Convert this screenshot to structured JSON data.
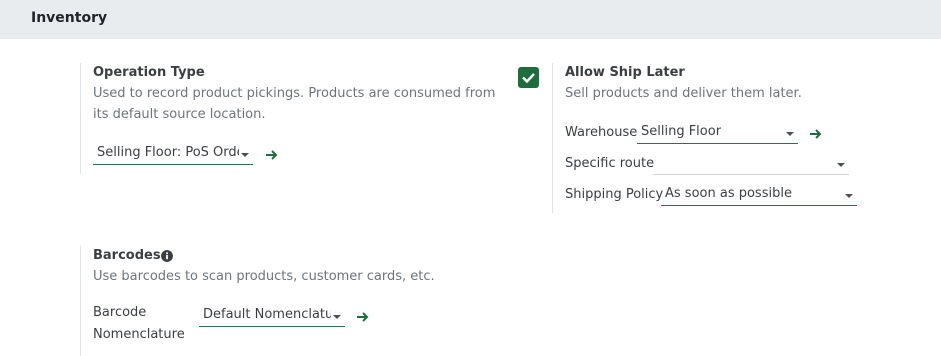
{
  "section": {
    "title": "Inventory"
  },
  "operation_type": {
    "title": "Operation Type",
    "description_line1": "Used to record product pickings. Products are consumed from",
    "description_line2": "its default source location.",
    "select_value": "Selling Floor: PoS Orde"
  },
  "allow_ship_later": {
    "title": "Allow Ship Later",
    "checked": true,
    "description": "Sell products and deliver them later.",
    "warehouse": {
      "label": "Warehouse",
      "value": "Selling Floor"
    },
    "specific_route": {
      "label": "Specific route",
      "value": ""
    },
    "shipping_policy": {
      "label": "Shipping Policy",
      "value": "As soon as possible"
    }
  },
  "barcodes": {
    "title": "Barcodes",
    "description": "Use barcodes to scan products, customer cards, etc.",
    "nomenclature": {
      "label_line1": "Barcode",
      "label_line2": "Nomenclature",
      "value": "Default Nomenclatu"
    }
  },
  "colors": {
    "accent": "#1e6e3b",
    "header_bg": "#e9ecef"
  },
  "icons": {
    "arrow": "arrow-right-icon",
    "check": "check-icon",
    "info": "info-icon",
    "caret": "caret-down-icon"
  }
}
